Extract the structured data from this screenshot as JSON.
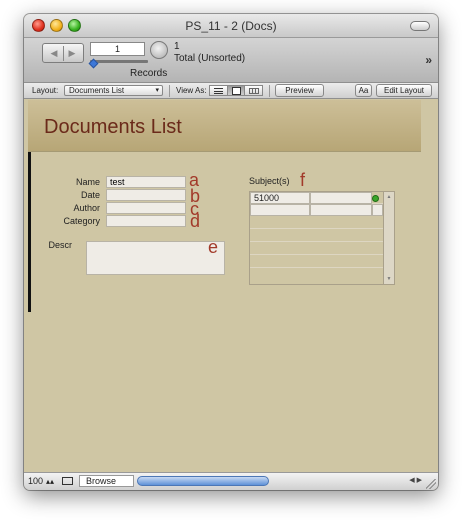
{
  "window": {
    "title": "PS_11 - 2 (Docs)"
  },
  "toolbar": {
    "record_number": "1",
    "found_count": "1",
    "total_label": "Total (Unsorted)",
    "records_label": "Records",
    "more_label": "»"
  },
  "layoutbar": {
    "layout_label": "Layout:",
    "layout_value": "Documents List",
    "view_as_label": "View As:",
    "preview_label": "Preview",
    "aa_label": "Aa",
    "edit_layout_label": "Edit Layout"
  },
  "form": {
    "title": "Documents List",
    "fields": [
      {
        "label": "Name",
        "value": "test",
        "letter": "a"
      },
      {
        "label": "Date",
        "value": "",
        "letter": "b"
      },
      {
        "label": "Author",
        "value": "",
        "letter": "c"
      },
      {
        "label": "Category",
        "value": "",
        "letter": "d"
      }
    ],
    "descr_label": "Descr",
    "descr_letter": "e",
    "subjects_label": "Subject(s)",
    "subjects_letter": "f",
    "subjects_rows": [
      "51000",
      "",
      "",
      "",
      "",
      "",
      ""
    ]
  },
  "statusbar": {
    "zoom": "100",
    "mode": "Browse"
  }
}
